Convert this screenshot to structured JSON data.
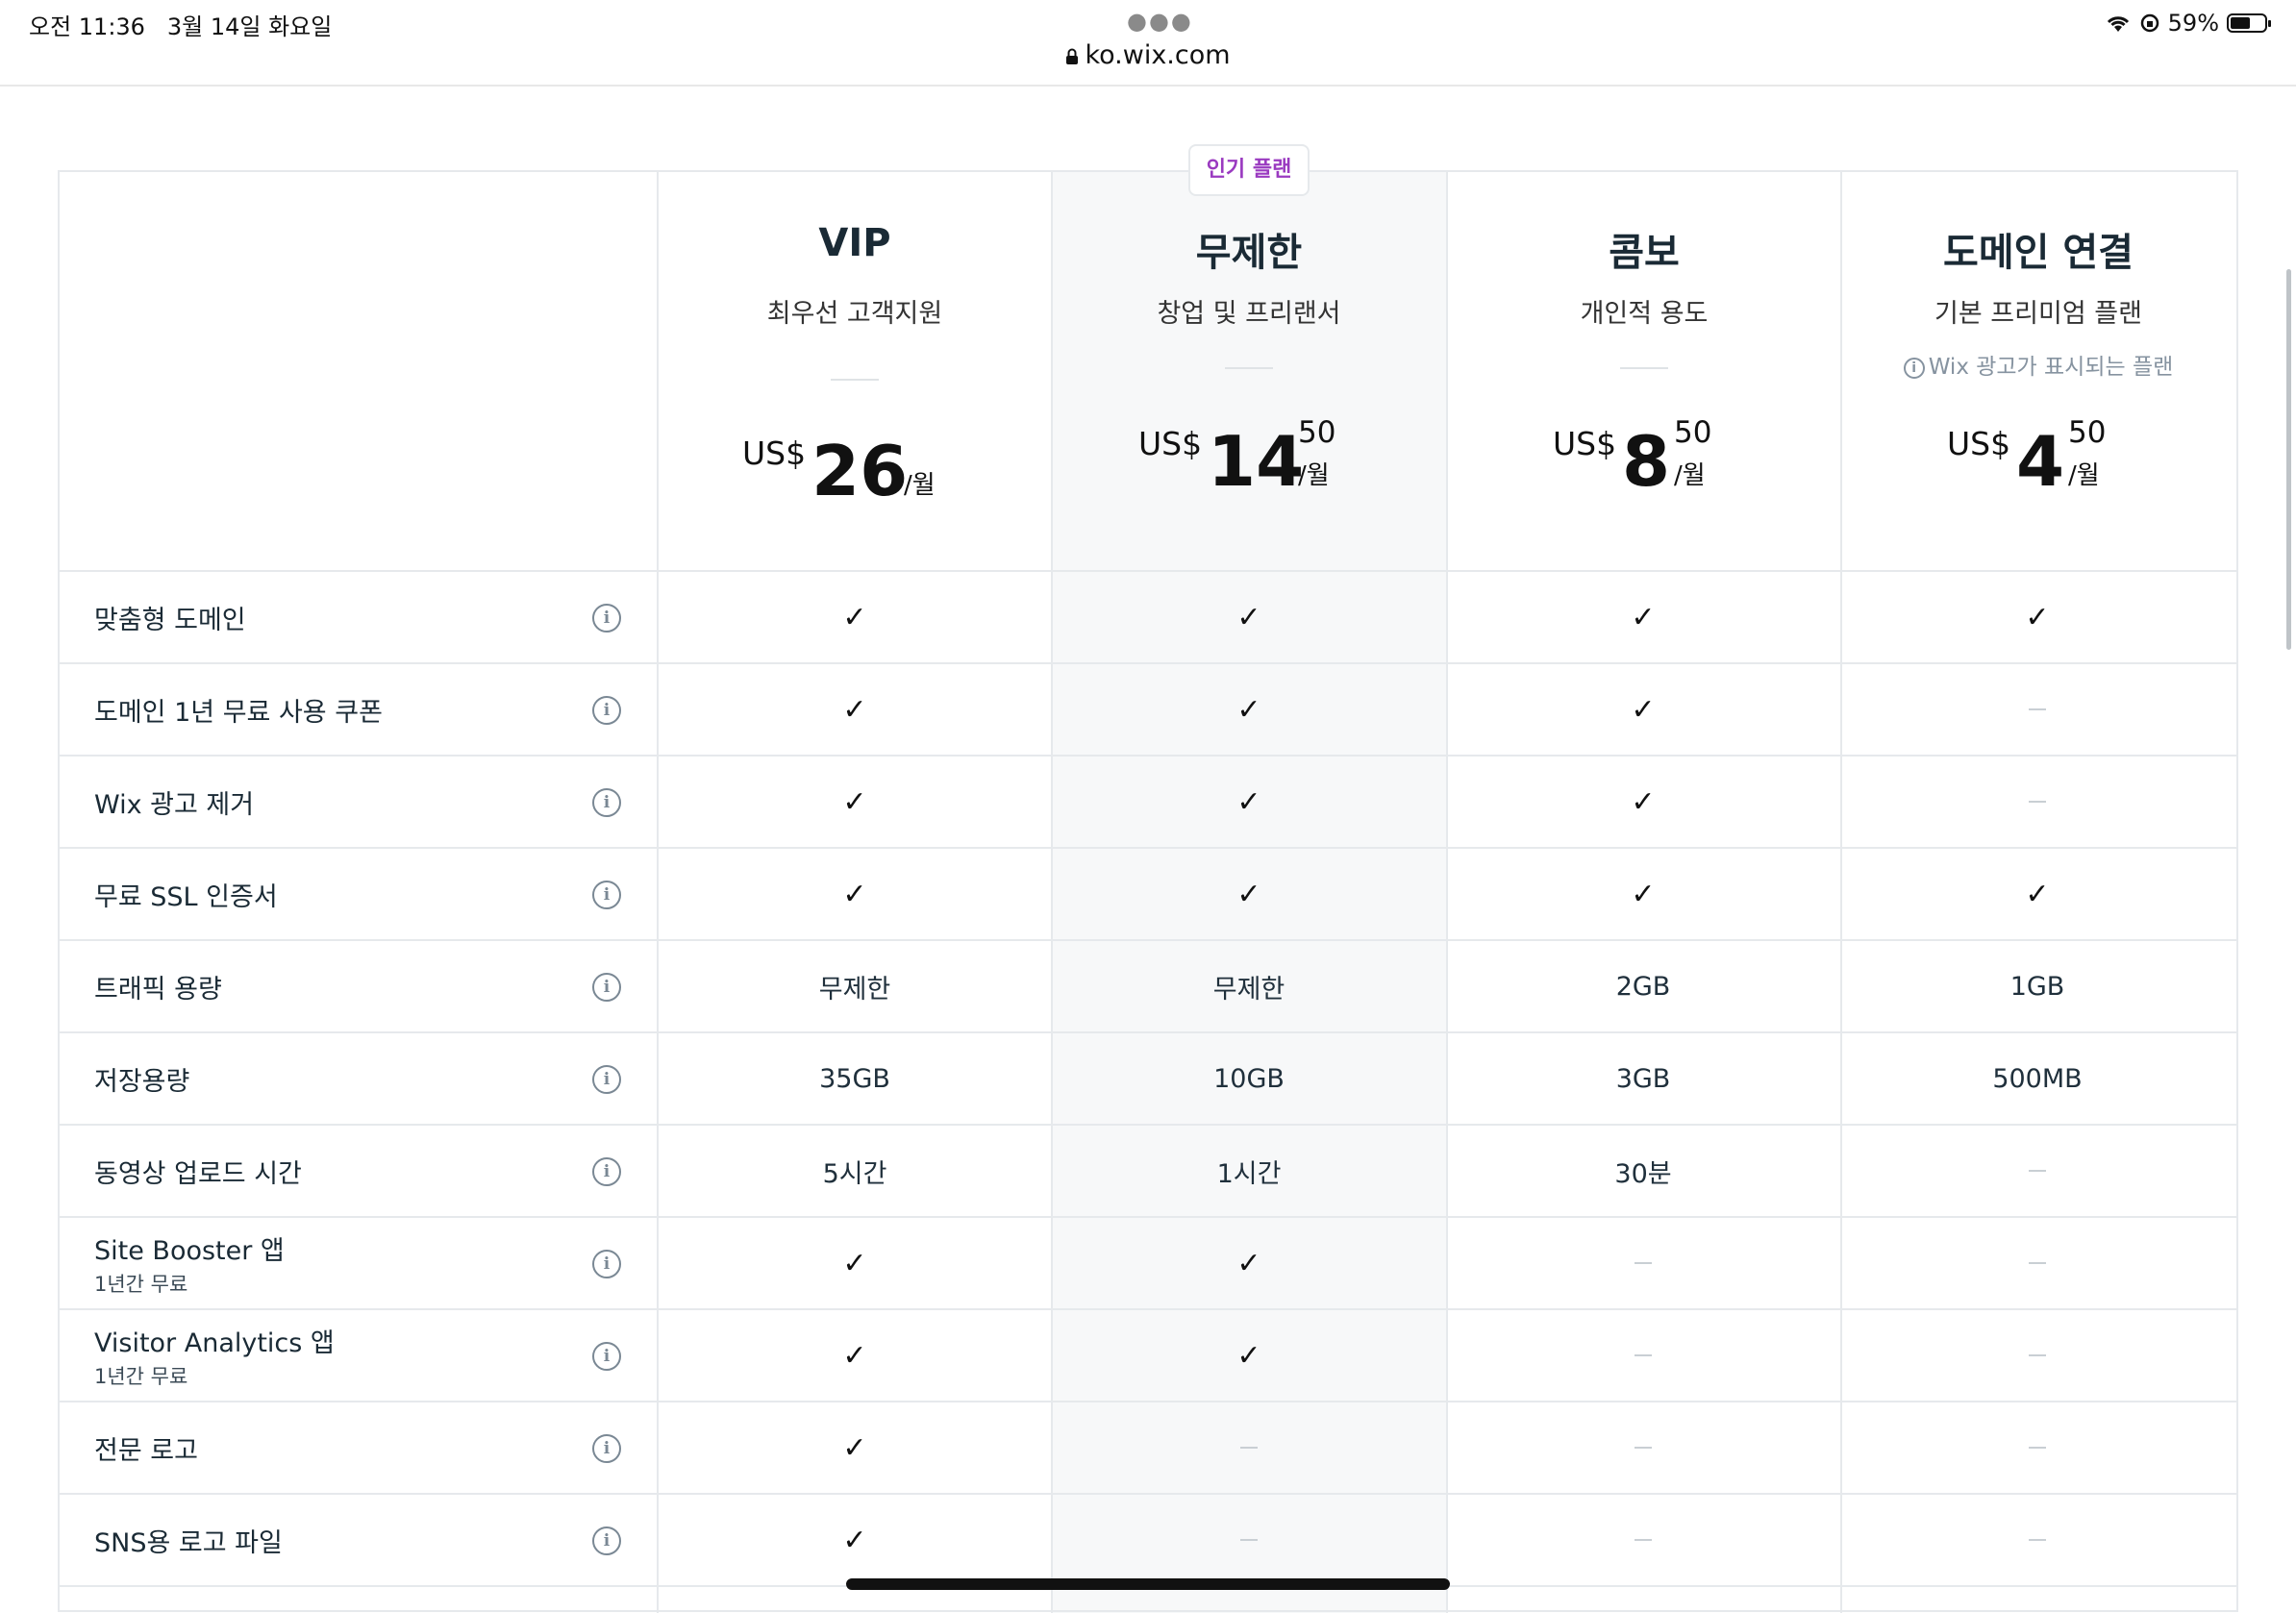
{
  "status_bar": {
    "time": "오전 11:36",
    "date": "3월 14일 화요일",
    "battery": "59%",
    "battery_level": 0.59,
    "url": "ko.wix.com"
  },
  "badge": "인기 플랜",
  "plans": [
    {
      "name": "VIP",
      "subtitle": "최우선 고객지원",
      "note": "",
      "currency": "US$",
      "price": "26",
      "cents": "",
      "per": "/월"
    },
    {
      "name": "무제한",
      "subtitle": "창업 및 프리랜서",
      "note": "",
      "currency": "US$",
      "price": "14",
      "cents": "50",
      "per": "/월"
    },
    {
      "name": "콤보",
      "subtitle": "개인적 용도",
      "note": "",
      "currency": "US$",
      "price": "8",
      "cents": "50",
      "per": "/월"
    },
    {
      "name": "도메인 연결",
      "subtitle": "기본 프리미엄 플랜",
      "note": "Wix 광고가 표시되는 플랜",
      "currency": "US$",
      "price": "4",
      "cents": "50",
      "per": "/월"
    }
  ],
  "features": [
    {
      "label": "맞춤형 도메인",
      "sub": "",
      "values": [
        "check",
        "check",
        "check",
        "check"
      ]
    },
    {
      "label": "도메인 1년 무료 사용 쿠폰",
      "sub": "",
      "values": [
        "check",
        "check",
        "check",
        "none"
      ]
    },
    {
      "label": "Wix 광고 제거",
      "sub": "",
      "values": [
        "check",
        "check",
        "check",
        "none"
      ]
    },
    {
      "label": "무료 SSL 인증서",
      "sub": "",
      "values": [
        "check",
        "check",
        "check",
        "check"
      ]
    },
    {
      "label": "트래픽 용량",
      "sub": "",
      "values": [
        "무제한",
        "무제한",
        "2GB",
        "1GB"
      ]
    },
    {
      "label": "저장용량",
      "sub": "",
      "values": [
        "35GB",
        "10GB",
        "3GB",
        "500MB"
      ]
    },
    {
      "label": "동영상 업로드 시간",
      "sub": "",
      "values": [
        "5시간",
        "1시간",
        "30분",
        "none"
      ]
    },
    {
      "label": "Site Booster 앱",
      "sub": "1년간 무료",
      "values": [
        "check",
        "check",
        "none",
        "none"
      ]
    },
    {
      "label": "Visitor Analytics 앱",
      "sub": "1년간 무료",
      "values": [
        "check",
        "check",
        "none",
        "none"
      ]
    },
    {
      "label": "전문 로고",
      "sub": "",
      "values": [
        "check",
        "none",
        "none",
        "none"
      ]
    },
    {
      "label": "SNS용 로고 파일",
      "sub": "",
      "values": [
        "check",
        "none",
        "none",
        "none"
      ]
    }
  ]
}
